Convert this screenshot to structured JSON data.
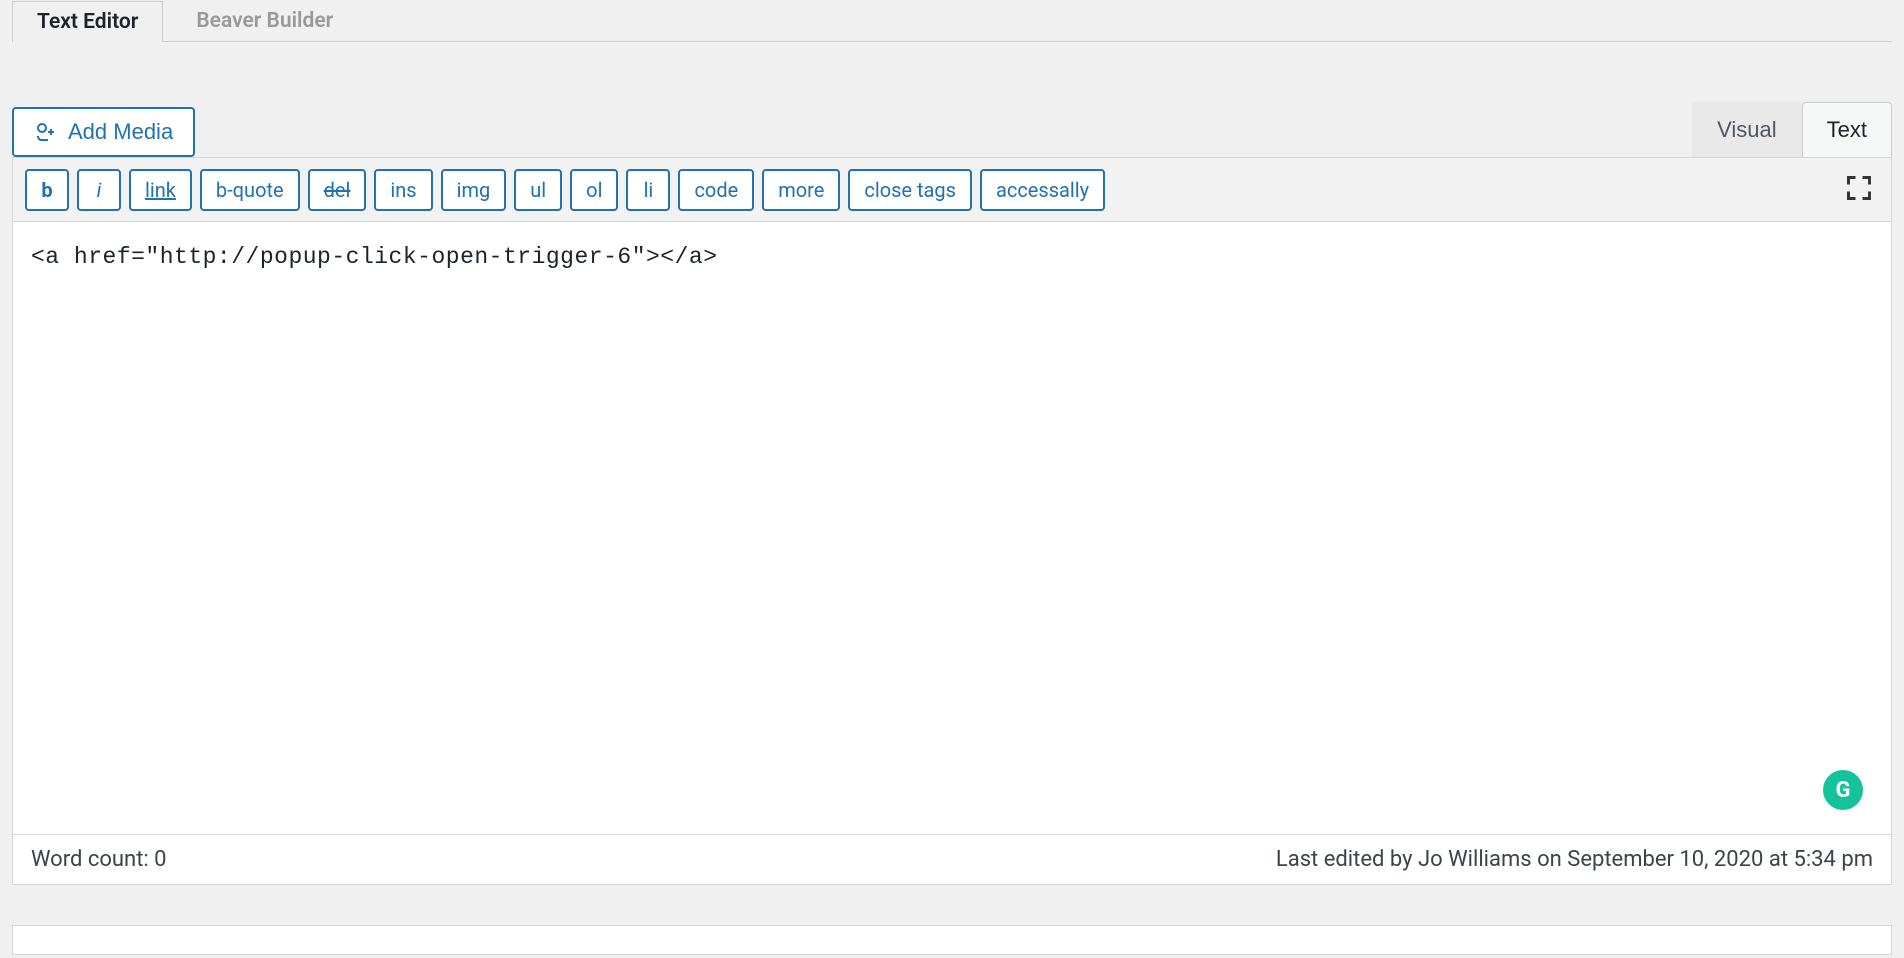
{
  "main_tabs": {
    "items": [
      {
        "label": "Text Editor",
        "active": true
      },
      {
        "label": "Beaver Builder",
        "active": false
      }
    ]
  },
  "editor": {
    "add_media_label": "Add Media",
    "view_tabs": {
      "visual": "Visual",
      "text": "Text"
    },
    "toolbar": {
      "b": "b",
      "i": "i",
      "link": "link",
      "b_quote": "b-quote",
      "del": "del",
      "ins": "ins",
      "img": "img",
      "ul": "ul",
      "ol": "ol",
      "li": "li",
      "code": "code",
      "more": "more",
      "close_tags": "close tags",
      "accessally": "accessally"
    },
    "content": "<a href=\"http://popup-click-open-trigger-6\"></a>",
    "grammarly_label": "G"
  },
  "status_bar": {
    "word_count_label": "Word count: 0",
    "last_edited_label": "Last edited by Jo Williams on September 10, 2020 at 5:34 pm"
  }
}
